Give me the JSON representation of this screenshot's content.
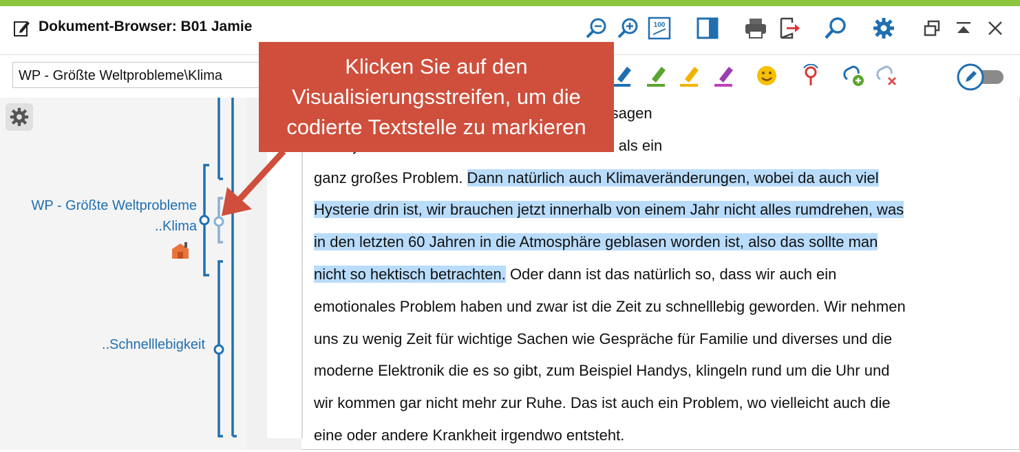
{
  "window": {
    "title": "Dokument-Browser: B01 Jamie",
    "accent_color": "#8cc63f",
    "toolbar_icons": [
      "zoom-out-icon",
      "zoom-in-icon",
      "zoom-100-icon",
      "sidebar-toggle-icon",
      "print-icon",
      "export-icon",
      "search-icon",
      "settings-icon",
      "undock-icon",
      "collapse-icon",
      "close-icon"
    ]
  },
  "toolbar": {
    "code_select_value": "WP - Größte Weltprobleme\\Klima",
    "tools": [
      "highlighter-blue-icon",
      "highlighter-green-icon",
      "highlighter-yellow-icon",
      "highlighter-purple-icon",
      "emoticode-icon",
      "memo-pin-icon",
      "add-code-icon",
      "remove-code-icon",
      "edit-mode-toggle"
    ]
  },
  "sidebar": {
    "code_label_1_line1": "WP - Größte Weltprobleme",
    "code_label_1_line2": "..Klima",
    "code_label_2": "..Schnelllebigkeit",
    "code_color": "#1f6fb0"
  },
  "document": {
    "lines": [
      {
        "pre": "Wasserstoff ist noch nicht soweit, dass man sagen",
        "hl": "",
        "post": ""
      },
      {
        "pre": "ist es ja noch nicht aufm Markt. Das sehe ich als ein",
        "hl": "",
        "post": ""
      },
      {
        "pre": "ganz großes Problem. ",
        "hl": "Dann natürlich auch Klimaveränderungen, wobei da auch viel",
        "post": ""
      },
      {
        "pre": "",
        "hl": "Hysterie drin ist, wir brauchen jetzt innerhalb von einem Jahr nicht alles rumdrehen, was",
        "post": ""
      },
      {
        "pre": "",
        "hl": "in den letzten 60 Jahren in die Atmosphäre geblasen worden ist, also das sollte man",
        "post": ""
      },
      {
        "pre": "",
        "hl": "nicht so hektisch betrachten.",
        "post": " Oder dann ist das natürlich so, dass wir auch ein"
      },
      {
        "pre": "emotionales Problem haben und zwar ist die Zeit zu schnelllebig geworden. Wir nehmen",
        "hl": "",
        "post": ""
      },
      {
        "pre": "uns zu wenig Zeit für wichtige Sachen wie Gespräche für Familie und diverses und die",
        "hl": "",
        "post": ""
      },
      {
        "pre": "moderne Elektronik die es so gibt, zum Beispiel Handys, klingeln rund um die Uhr und",
        "hl": "",
        "post": ""
      },
      {
        "pre": "wir kommen gar nicht mehr zur Ruhe. Das ist auch ein Problem, wo vielleicht auch die",
        "hl": "",
        "post": ""
      },
      {
        "pre": "eine oder andere Krankheit irgendwo entsteht.",
        "hl": "",
        "post": ""
      }
    ],
    "highlight_color": "#b9dcfb"
  },
  "callout": {
    "line1": "Klicken Sie auf den",
    "line2": "Visualisierungsstreifen, um die",
    "line3": "codierte Textstelle zu markieren",
    "color": "#cf4f3c"
  }
}
